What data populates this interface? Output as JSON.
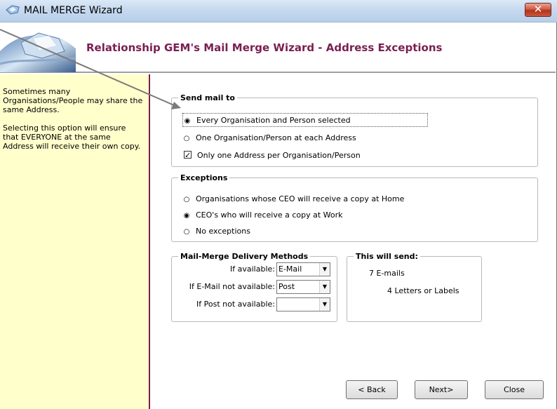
{
  "window": {
    "title": "MAIL MERGE Wizard",
    "close_glyph": "✕"
  },
  "banner": {
    "title": "Relationship GEM's Mail Merge Wizard - Address Exceptions"
  },
  "help": {
    "para1": "Sometimes many Organisations/People may share the same Address.",
    "para2": "Selecting this option will ensure that EVERYONE at the same Address will receive their own copy."
  },
  "send_mail": {
    "legend": "Send mail to",
    "options": [
      {
        "label": "Every Organisation and Person selected",
        "selected": true
      },
      {
        "label": "One Organisation/Person at each Address",
        "selected": false
      }
    ],
    "checkbox": {
      "label": "Only one Address per Organisation/Person",
      "checked": true
    }
  },
  "exceptions": {
    "legend": "Exceptions",
    "options": [
      {
        "label": "Organisations whose CEO will receive a copy at Home",
        "selected": false
      },
      {
        "label": "CEO's who will receive a copy at Work",
        "selected": true
      },
      {
        "label": "No exceptions",
        "selected": false
      }
    ]
  },
  "delivery": {
    "legend": "Mail-Merge Delivery Methods",
    "rows": [
      {
        "label": "If available:",
        "value": "E-Mail"
      },
      {
        "label": "If E-Mail not available:",
        "value": "Post"
      },
      {
        "label": "If Post not available:",
        "value": ""
      }
    ]
  },
  "summary": {
    "legend": "This will send:",
    "emails": "7  E-mails",
    "letters": "4  Letters or Labels"
  },
  "buttons": {
    "back": "< Back",
    "next": "Next>",
    "close": "Close"
  },
  "icons": {
    "radio_on": "◉",
    "radio_off": "○",
    "check": "✓",
    "dropdown": "▼"
  },
  "colors": {
    "accent": "#7a1f52",
    "help_bg": "#ffffcc"
  }
}
